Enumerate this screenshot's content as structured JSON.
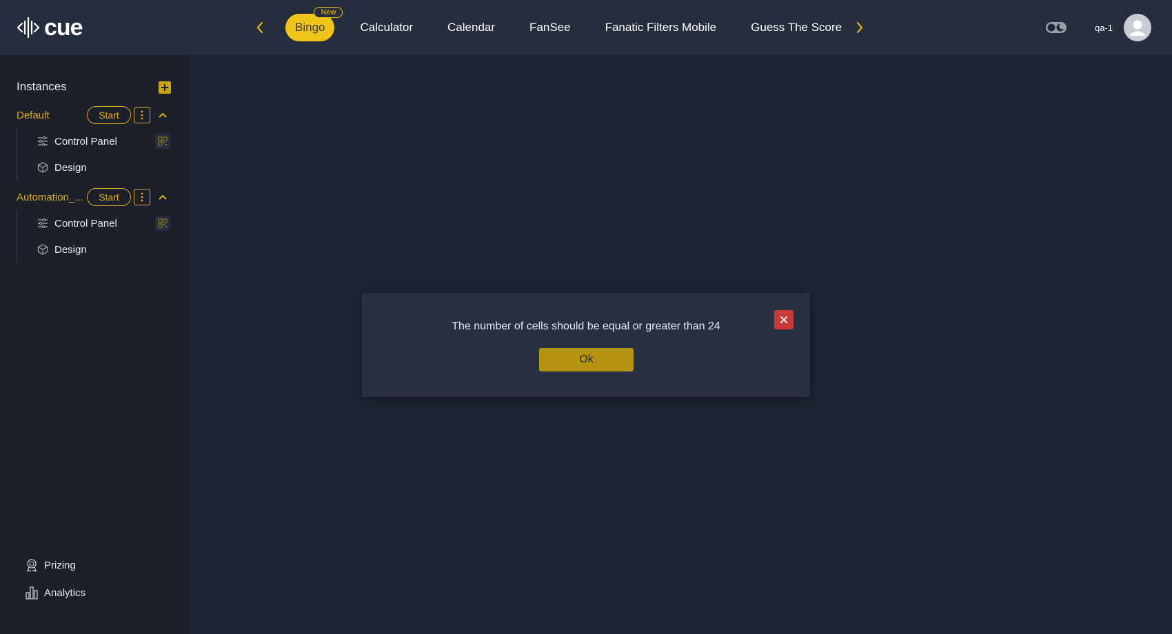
{
  "brand": {
    "name": "cue"
  },
  "nav": {
    "tabs": [
      {
        "label": "Bingo",
        "badge": "New",
        "active": true
      },
      {
        "label": "Calculator"
      },
      {
        "label": "Calendar"
      },
      {
        "label": "FanSee"
      },
      {
        "label": "Fanatic Filters Mobile"
      },
      {
        "label": "Guess The Score"
      }
    ]
  },
  "user": {
    "name": "qa-1"
  },
  "sidebar": {
    "title": "Instances",
    "instances": [
      {
        "name": "Default",
        "start_label": "Start",
        "children": [
          {
            "label": "Control Panel",
            "icon": "sliders-icon",
            "has_qr": true
          },
          {
            "label": "Design",
            "icon": "cube-icon",
            "has_qr": false
          }
        ]
      },
      {
        "name": "Automation_...",
        "start_label": "Start",
        "children": [
          {
            "label": "Control Panel",
            "icon": "sliders-icon",
            "has_qr": true
          },
          {
            "label": "Design",
            "icon": "cube-icon",
            "has_qr": false
          }
        ]
      }
    ],
    "bottom": [
      {
        "label": "Prizing",
        "icon": "award-icon"
      },
      {
        "label": "Analytics",
        "icon": "bar-chart-icon"
      }
    ]
  },
  "modal": {
    "message": "The number of cells should be equal or greater than 24",
    "ok_label": "Ok"
  },
  "colors": {
    "accent": "#f0c419",
    "accent_text": "#e0aa1c",
    "background": "#1e2433",
    "header": "#262d3c",
    "sidebar": "#1b202b",
    "danger": "#c83a3a"
  }
}
